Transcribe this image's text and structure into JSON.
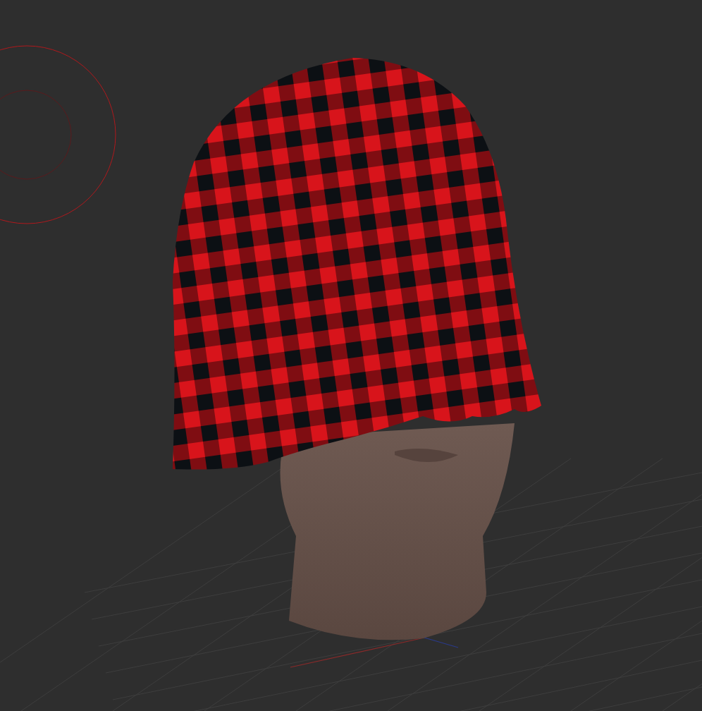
{
  "viewport": {
    "grid": true,
    "brush_cursor": true,
    "axes": true
  }
}
